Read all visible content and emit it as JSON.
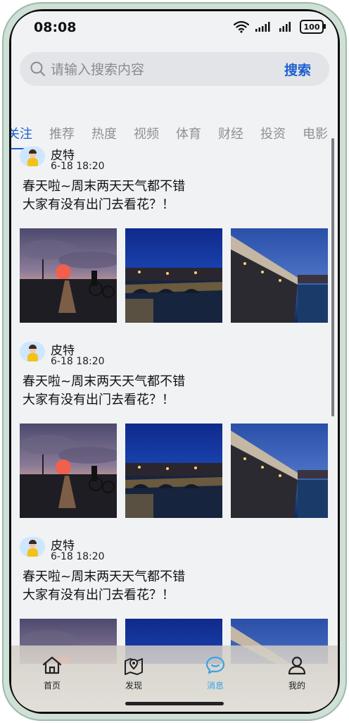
{
  "status_bar": {
    "time": "08:08",
    "battery": "100"
  },
  "search": {
    "placeholder": "请输入搜索内容",
    "button": "搜索"
  },
  "tabs": [
    {
      "label": "关注",
      "active": true
    },
    {
      "label": "推荐"
    },
    {
      "label": "热度"
    },
    {
      "label": "视频"
    },
    {
      "label": "体育"
    },
    {
      "label": "财经"
    },
    {
      "label": "投资"
    },
    {
      "label": "电影"
    }
  ],
  "posts": [
    {
      "user": "皮特",
      "date": "6-18 18:20",
      "text": "春天啦~周末两天天气都不错\n 大家有没有出门去看花？！"
    },
    {
      "user": "皮特",
      "date": "6-18 18:20",
      "text": "春天啦~周末两天天气都不错\n 大家有没有出门去看花？！"
    },
    {
      "user": "皮特",
      "date": "6-18 18:20",
      "text": "春天啦~周末两天天气都不错\n 大家有没有出门去看花？！"
    }
  ],
  "bottom_nav": [
    {
      "label": "首页",
      "icon": "home-icon"
    },
    {
      "label": "发现",
      "icon": "map-icon"
    },
    {
      "label": "消息",
      "icon": "message-icon",
      "active": true
    },
    {
      "label": "我的",
      "icon": "person-icon"
    }
  ],
  "colors": {
    "accent": "#1a5fd1",
    "active_nav": "#3aa3e3"
  }
}
